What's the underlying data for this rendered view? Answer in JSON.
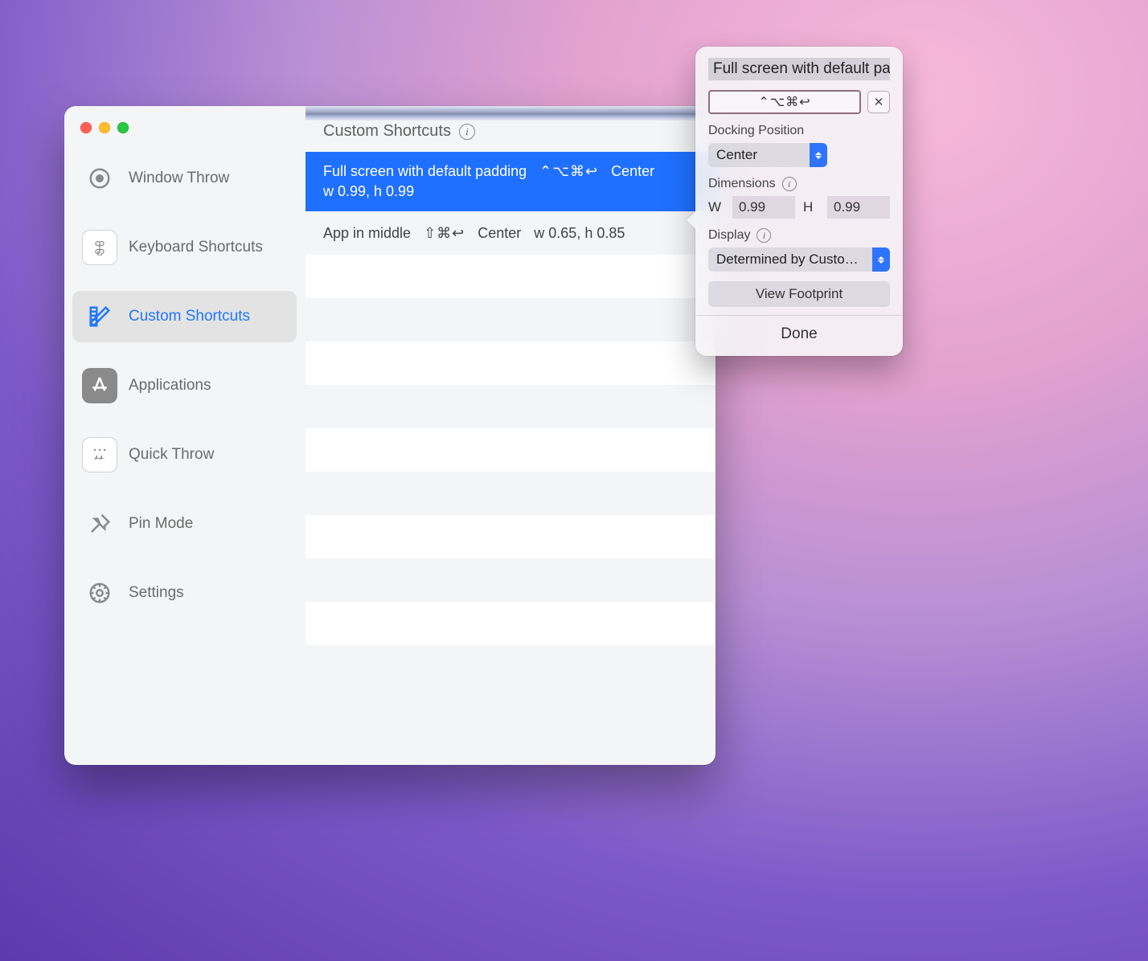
{
  "sidebar": {
    "items": [
      {
        "label": "Window Throw"
      },
      {
        "label": "Keyboard Shortcuts"
      },
      {
        "label": "Custom Shortcuts"
      },
      {
        "label": "Applications"
      },
      {
        "label": "Quick Throw"
      },
      {
        "label": "Pin Mode"
      },
      {
        "label": "Settings"
      }
    ],
    "active_index": 2
  },
  "main": {
    "header": "Custom Shortcuts",
    "rows": [
      {
        "name": "Full screen with default padding",
        "keys": "⌃⌥⌘↩",
        "position": "Center",
        "dims": "w 0.99, h 0.99",
        "selected": true
      },
      {
        "name": "App in middle",
        "keys": "⇧⌘↩",
        "position": "Center",
        "dims": "w 0.65, h 0.85",
        "selected": false
      }
    ]
  },
  "popover": {
    "title": "Full screen with default pad",
    "key_field": "⌃⌥⌘↩",
    "clear_glyph": "✕",
    "docking_label": "Docking Position",
    "docking_value": "Center",
    "dimensions_label": "Dimensions",
    "w_label": "W",
    "w_value": "0.99",
    "h_label": "H",
    "h_value": "0.99",
    "display_label": "Display",
    "display_value": "Determined by Custo…",
    "view_footprint": "View Footprint",
    "done": "Done"
  }
}
